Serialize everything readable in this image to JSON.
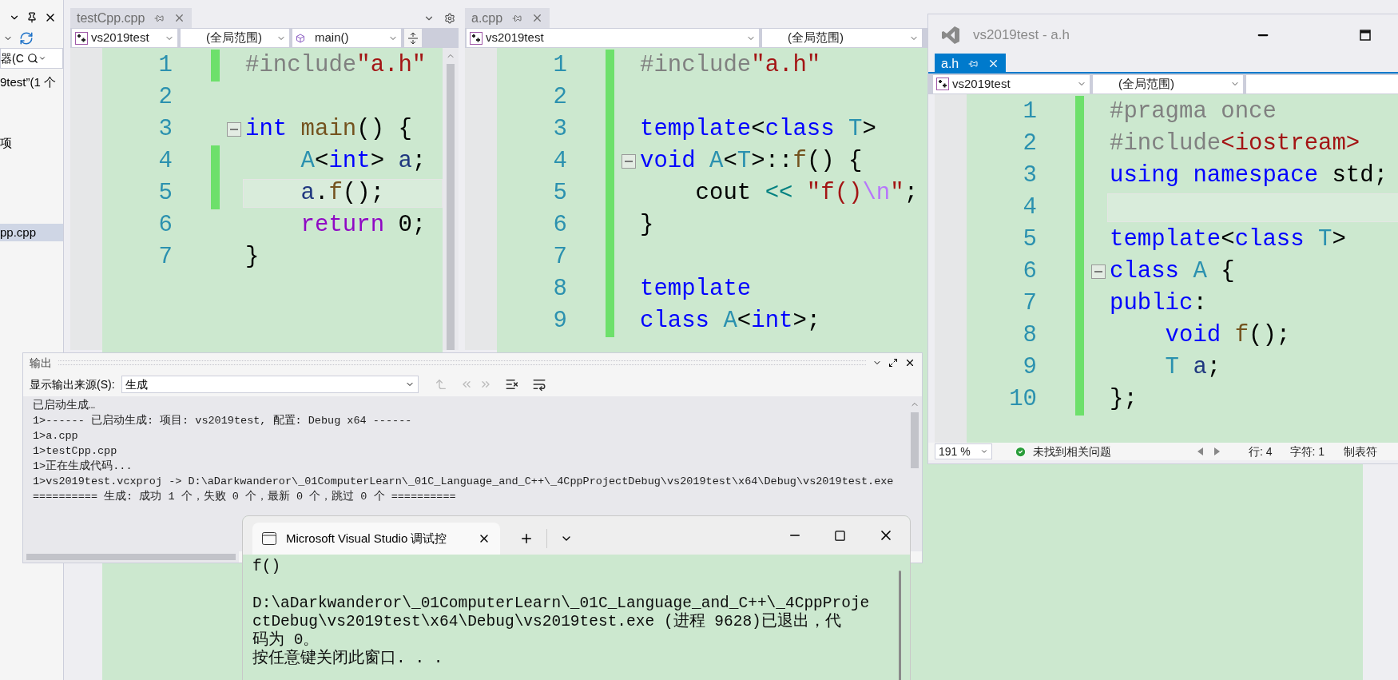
{
  "solution_explorer": {
    "search": {
      "value": "器(C"
    },
    "items": [
      {
        "label": "9test”(1 个",
        "selected": false
      },
      {
        "label": "项",
        "selected": false
      },
      {
        "label": "pp.cpp",
        "selected": true
      }
    ]
  },
  "editors": [
    {
      "tab": {
        "label": "testCpp.cpp",
        "selected": false
      },
      "project": "vs2019test",
      "scope": "(全局范围)",
      "member": "main()",
      "lines": [
        {
          "n": "1",
          "changed": true,
          "fold": false,
          "current": false,
          "code": [
            {
              "kind": "pp",
              "text": "#include"
            },
            {
              "kind": "str",
              "text": "\"a.h\""
            }
          ]
        },
        {
          "n": "2",
          "changed": false,
          "fold": false,
          "current": false
        },
        {
          "n": "3",
          "changed": false,
          "fold": true,
          "current": false,
          "code": [
            {
              "kind": "kw",
              "text": "int"
            },
            {
              "kind": "fn",
              "text": " main"
            },
            {
              "kind": "plain",
              "text": "() {"
            }
          ]
        },
        {
          "n": "4",
          "changed": true,
          "fold": false,
          "current": false,
          "code": [
            {
              "kind": "type",
              "text": "    A"
            },
            {
              "kind": "plain",
              "text": "<"
            },
            {
              "kind": "kw",
              "text": "int"
            },
            {
              "kind": "plain",
              "text": ">"
            },
            {
              "kind": "var",
              "text": " a"
            },
            {
              "kind": "plain",
              "text": ";"
            }
          ]
        },
        {
          "n": "5",
          "changed": true,
          "fold": false,
          "current": true,
          "code": [
            {
              "kind": "var",
              "text": "    a"
            },
            {
              "kind": "plain",
              "text": "."
            },
            {
              "kind": "fn",
              "text": "f"
            },
            {
              "kind": "plain",
              "text": "();"
            }
          ]
        },
        {
          "n": "6",
          "changed": false,
          "fold": false,
          "current": false,
          "code": [
            {
              "kind": "ctl",
              "text": "    return"
            },
            {
              "kind": "plain",
              "text": " 0;"
            }
          ]
        },
        {
          "n": "7",
          "changed": false,
          "fold": false,
          "current": false,
          "code": [
            {
              "kind": "plain",
              "text": "}"
            }
          ]
        }
      ]
    },
    {
      "tab": {
        "label": "a.cpp",
        "selected": false
      },
      "project": "vs2019test",
      "scope": "(全局范围)",
      "lines": [
        {
          "n": "1",
          "changed": true,
          "fold": false,
          "current": false,
          "code": [
            {
              "kind": "pp",
              "text": "#include"
            },
            {
              "kind": "str",
              "text": "\"a.h\""
            }
          ]
        },
        {
          "n": "2",
          "changed": true,
          "fold": false,
          "current": false
        },
        {
          "n": "3",
          "changed": true,
          "fold": false,
          "current": false,
          "code": [
            {
              "kind": "kw",
              "text": "template"
            },
            {
              "kind": "plain",
              "text": "<"
            },
            {
              "kind": "kw",
              "text": "class"
            },
            {
              "kind": "type",
              "text": " T"
            },
            {
              "kind": "plain",
              "text": ">"
            }
          ]
        },
        {
          "n": "4",
          "changed": true,
          "fold": true,
          "current": false,
          "code": [
            {
              "kind": "kw",
              "text": "void"
            },
            {
              "kind": "type",
              "text": " A"
            },
            {
              "kind": "plain",
              "text": "<"
            },
            {
              "kind": "type",
              "text": "T"
            },
            {
              "kind": "plain",
              "text": ">::"
            },
            {
              "kind": "fn",
              "text": "f"
            },
            {
              "kind": "plain",
              "text": "() {"
            }
          ]
        },
        {
          "n": "5",
          "changed": true,
          "fold": false,
          "current": false,
          "code": [
            {
              "kind": "plain",
              "text": "    cout"
            },
            {
              "kind": "op",
              "text": " <<"
            },
            {
              "kind": "str",
              "text": " \"f()"
            },
            {
              "kind": "esc",
              "text": "\\n"
            },
            {
              "kind": "str",
              "text": "\""
            },
            {
              "kind": "plain",
              "text": ";"
            }
          ]
        },
        {
          "n": "6",
          "changed": true,
          "fold": false,
          "current": false,
          "code": [
            {
              "kind": "plain",
              "text": "}"
            }
          ]
        },
        {
          "n": "7",
          "changed": true,
          "fold": false,
          "current": false
        },
        {
          "n": "8",
          "changed": true,
          "fold": false,
          "current": false,
          "code": [
            {
              "kind": "kw",
              "text": "template"
            }
          ]
        },
        {
          "n": "9",
          "changed": true,
          "fold": false,
          "current": false,
          "code": [
            {
              "kind": "kw",
              "text": "class"
            },
            {
              "kind": "type",
              "text": " A"
            },
            {
              "kind": "plain",
              "text": "<"
            },
            {
              "kind": "kw",
              "text": "int"
            },
            {
              "kind": "plain",
              "text": ">;"
            }
          ]
        }
      ]
    }
  ],
  "float_window": {
    "title": "vs2019test - a.h",
    "tab": {
      "label": "a.h",
      "selected": true
    },
    "project": "vs2019test",
    "scope": "(全局范围)",
    "lines": [
      {
        "n": "1",
        "changed": true,
        "fold": false,
        "current": false,
        "code": [
          {
            "kind": "pp",
            "text": "#pragma once"
          }
        ]
      },
      {
        "n": "2",
        "changed": true,
        "fold": false,
        "current": false,
        "code": [
          {
            "kind": "pp",
            "text": "#include"
          },
          {
            "kind": "str",
            "text": "<iostream>"
          }
        ]
      },
      {
        "n": "3",
        "changed": true,
        "fold": false,
        "current": false,
        "code": [
          {
            "kind": "kw",
            "text": "using namespace"
          },
          {
            "kind": "plain",
            "text": " std;"
          }
        ]
      },
      {
        "n": "4",
        "changed": true,
        "fold": false,
        "current": true
      },
      {
        "n": "5",
        "changed": true,
        "fold": false,
        "current": false,
        "code": [
          {
            "kind": "kw",
            "text": "template"
          },
          {
            "kind": "plain",
            "text": "<"
          },
          {
            "kind": "kw",
            "text": "class"
          },
          {
            "kind": "type",
            "text": " T"
          },
          {
            "kind": "plain",
            "text": ">"
          }
        ]
      },
      {
        "n": "6",
        "changed": true,
        "fold": true,
        "current": false,
        "code": [
          {
            "kind": "kw",
            "text": "class"
          },
          {
            "kind": "type",
            "text": " A"
          },
          {
            "kind": "plain",
            "text": " {"
          }
        ]
      },
      {
        "n": "7",
        "changed": true,
        "fold": false,
        "current": false,
        "code": [
          {
            "kind": "kw",
            "text": "public"
          },
          {
            "kind": "plain",
            "text": ":"
          }
        ]
      },
      {
        "n": "8",
        "changed": true,
        "fold": false,
        "current": false,
        "code": [
          {
            "kind": "kw",
            "text": "    void"
          },
          {
            "kind": "fn",
            "text": " f"
          },
          {
            "kind": "plain",
            "text": "();"
          }
        ]
      },
      {
        "n": "9",
        "changed": true,
        "fold": false,
        "current": false,
        "code": [
          {
            "kind": "type",
            "text": "    T"
          },
          {
            "kind": "var",
            "text": " a"
          },
          {
            "kind": "plain",
            "text": ";"
          }
        ]
      },
      {
        "n": "10",
        "changed": true,
        "fold": false,
        "current": false,
        "code": [
          {
            "kind": "plain",
            "text": "};"
          }
        ]
      }
    ],
    "status": {
      "zoom": "191 %",
      "issues": "未找到相关问题",
      "line": "行: 4",
      "char": "字符: 1",
      "indent": "制表符"
    }
  },
  "output": {
    "title": "输出",
    "source_label": "显示输出来源(S):",
    "source": "生成",
    "lines": [
      "已启动生成…",
      "1>------ 已启动生成: 项目: vs2019test, 配置: Debug x64 ------",
      "1>a.cpp",
      "1>testCpp.cpp",
      "1>正在生成代码...",
      "1>vs2019test.vcxproj -> D:\\aDarkwanderor\\_01ComputerLearn\\_01C_Language_and_C++\\_4CppProjectDebug\\vs2019test\\x64\\Debug\\vs2019test.exe",
      "========== 生成: 成功 1 个，失败 0 个，最新 0 个，跳过 0 个 =========="
    ]
  },
  "console": {
    "tab_title": "Microsoft Visual Studio 调试控",
    "lines": [
      {
        "text": "f()",
        "space_before": false
      },
      {
        "text": "D:\\aDarkwanderor\\_01ComputerLearn\\_01C_Language_and_C++\\_4CppProje",
        "space_before": true
      },
      {
        "text": "ctDebug\\vs2019test\\x64\\Debug\\vs2019test.exe (进程 9628)已退出，代",
        "space_before": false
      },
      {
        "text": "码为 0。",
        "space_before": false
      },
      {
        "text": "按任意键关闭此窗口. . .",
        "space_before": false
      }
    ]
  }
}
